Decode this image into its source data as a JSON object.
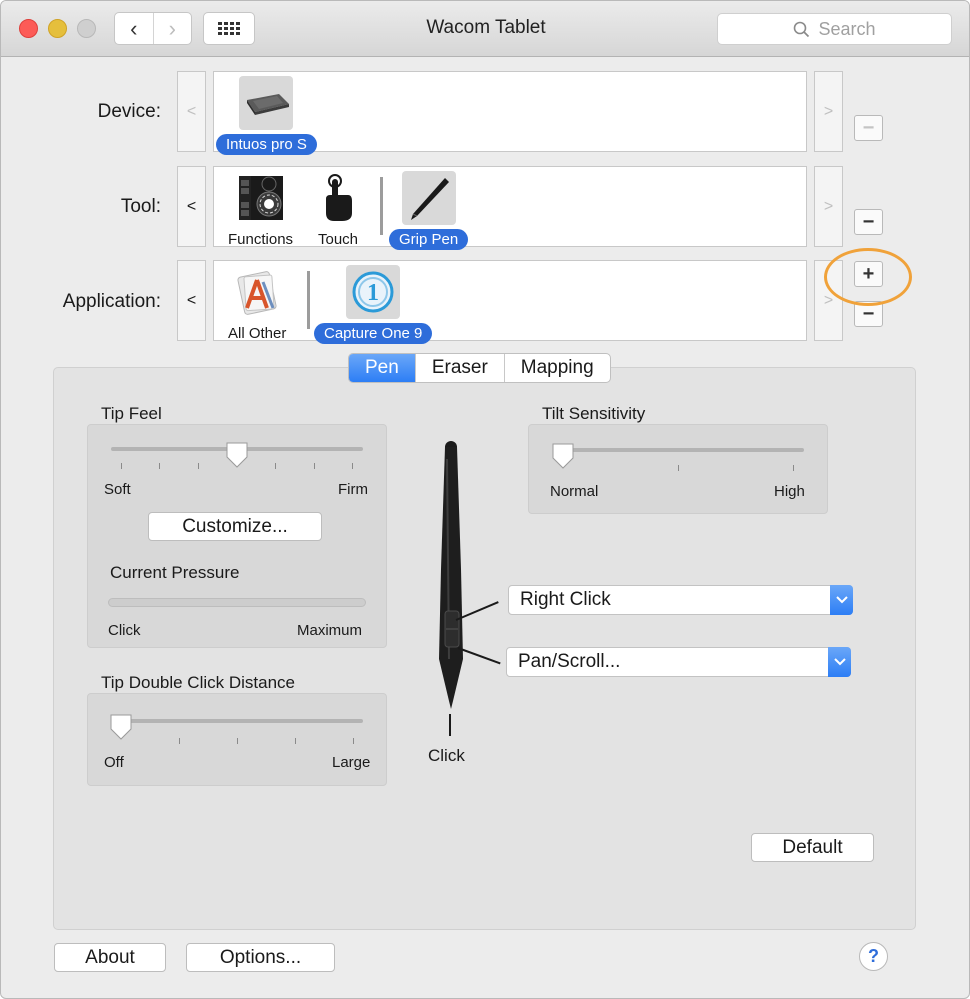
{
  "window": {
    "title": "Wacom Tablet"
  },
  "search": {
    "placeholder": "Search",
    "icon": "search-icon"
  },
  "device": {
    "label": "Device:",
    "items": [
      {
        "label": "Intuos pro S",
        "selected": true
      }
    ]
  },
  "tool": {
    "label": "Tool:",
    "items": [
      {
        "label": "Functions",
        "selected": false
      },
      {
        "label": "Touch",
        "selected": false
      },
      {
        "label": "Grip Pen",
        "selected": true
      }
    ]
  },
  "application": {
    "label": "Application:",
    "items": [
      {
        "label": "All Other",
        "selected": false
      },
      {
        "label": "Capture One 9",
        "selected": true
      }
    ]
  },
  "tabs": [
    {
      "label": "Pen",
      "active": true
    },
    {
      "label": "Eraser",
      "active": false
    },
    {
      "label": "Mapping",
      "active": false
    }
  ],
  "tip_feel": {
    "title": "Tip Feel",
    "min_label": "Soft",
    "max_label": "Firm",
    "value_fraction": 0.5,
    "customize_label": "Customize..."
  },
  "current_pressure": {
    "title": "Current Pressure",
    "min_label": "Click",
    "max_label": "Maximum",
    "value_fraction": 0
  },
  "tip_double_click": {
    "title": "Tip Double Click Distance",
    "min_label": "Off",
    "max_label": "Large",
    "value_fraction": 0
  },
  "tilt": {
    "title": "Tilt Sensitivity",
    "min_label": "Normal",
    "max_label": "High",
    "value_fraction": 0
  },
  "pen_buttons": {
    "upper": "Right Click",
    "lower": "Pan/Scroll...",
    "tip": "Click"
  },
  "buttons": {
    "default": "Default",
    "about": "About",
    "options": "Options...",
    "help": "?"
  },
  "colors": {
    "accent": "#2e6dda",
    "highlight_ring": "#f0a23a"
  }
}
